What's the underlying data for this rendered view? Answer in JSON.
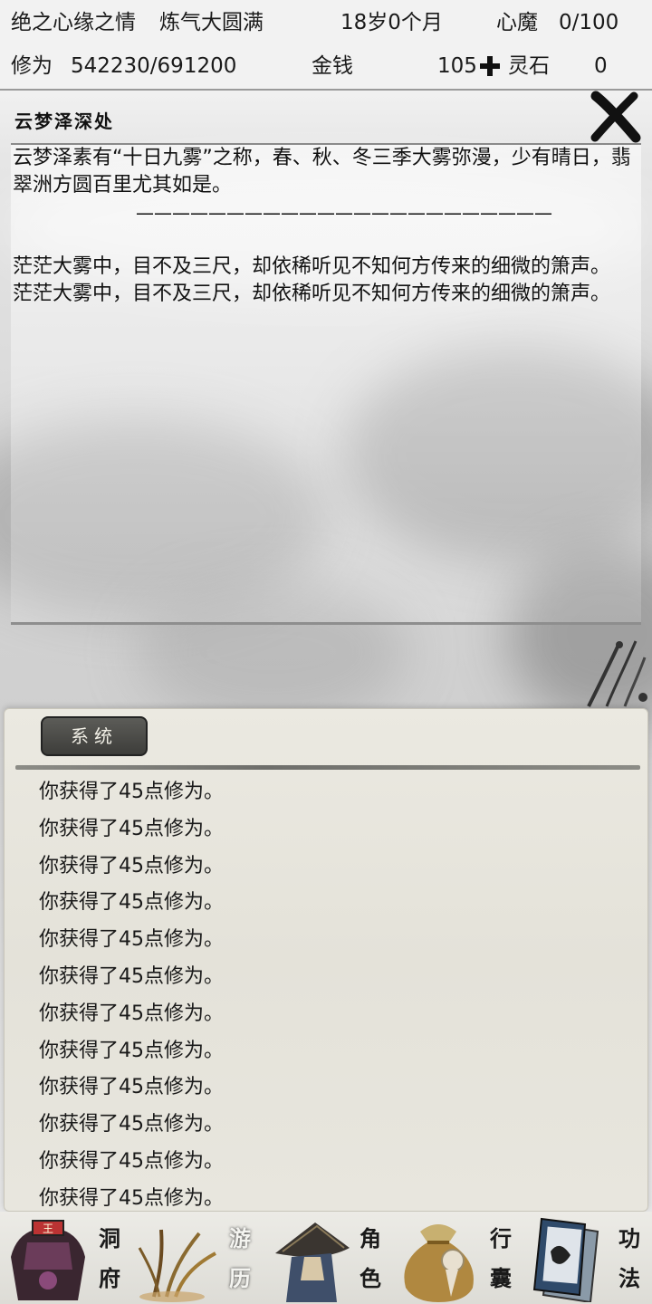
{
  "status": {
    "realm_title": "绝之心缘之情",
    "cultivation_stage": "炼气大圆满",
    "age": "18岁0个月",
    "heart_demon_label": "心魔",
    "heart_demon_value": "0/100",
    "cultivation_label": "修为",
    "cultivation_value": "542230/691200",
    "money_label": "金钱",
    "money_value": "105",
    "spirit_stone_label": "灵石",
    "spirit_stone_value": "0"
  },
  "location": {
    "title": "云梦泽深处",
    "paragraphs": [
      "云梦泽素有“十日九雾”之称，春、秋、冬三季大雾弥漫，少有晴日，翡翠洲方圆百里尤其如是。",
      "———————————————————————",
      "茫茫大雾中，目不及三尺，却依稀听见不知何方传来的细微的箫声。",
      "茫茫大雾中，目不及三尺，却依稀听见不知何方传来的细微的箫声。"
    ]
  },
  "log": {
    "tab_label": "系统",
    "entries": [
      "你获得了45点修为。",
      "你获得了45点修为。",
      "你获得了45点修为。",
      "你获得了45点修为。",
      "你获得了45点修为。",
      "你获得了45点修为。",
      "你获得了45点修为。",
      "你获得了45点修为。",
      "你获得了45点修为。",
      "你获得了45点修为。",
      "你获得了45点修为。",
      "你获得了45点修为。"
    ]
  },
  "nav": {
    "items": [
      {
        "label_top": "洞",
        "label_bottom": "府",
        "icon": "cave-dwelling-icon"
      },
      {
        "label_top": "游",
        "label_bottom": "历",
        "icon": "travel-grass-icon"
      },
      {
        "label_top": "角",
        "label_bottom": "色",
        "icon": "straw-hat-icon"
      },
      {
        "label_top": "行",
        "label_bottom": "囊",
        "icon": "pouch-bag-icon"
      },
      {
        "label_top": "功",
        "label_bottom": "法",
        "icon": "scroll-books-icon"
      }
    ],
    "active_index": 1
  },
  "colors": {
    "panel_bg": "#e8e6de",
    "tab_bg": "#3d3d3a",
    "text": "#111111"
  }
}
